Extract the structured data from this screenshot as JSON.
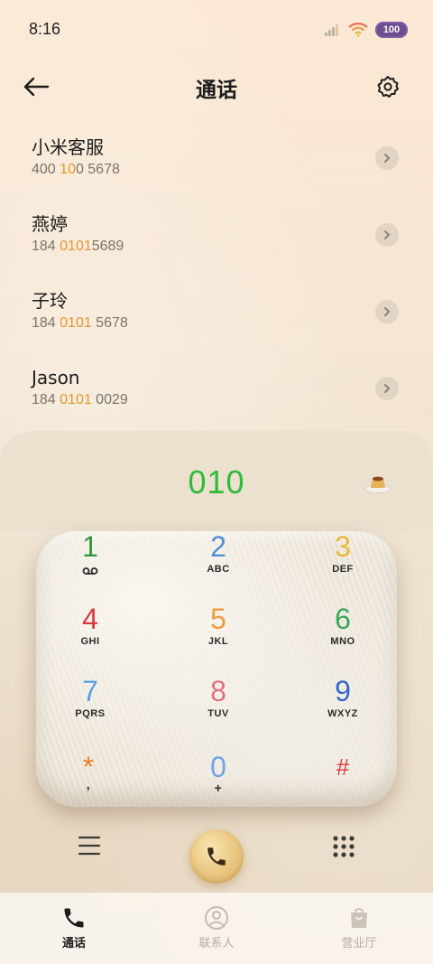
{
  "status_bar": {
    "time": "8:16",
    "battery": "100"
  },
  "header": {
    "title": "通话"
  },
  "contacts": [
    {
      "name": "小米客服",
      "number_parts": [
        "400 ",
        "10",
        "0 5678"
      ]
    },
    {
      "name": "燕婷",
      "number_parts": [
        "184 ",
        "0101",
        "5689"
      ]
    },
    {
      "name": "子玲",
      "number_parts": [
        "184 ",
        "0101",
        " 5678"
      ]
    },
    {
      "name": "Jason",
      "number_parts": [
        "184 ",
        "0101",
        " 0029"
      ]
    }
  ],
  "dialer": {
    "entered_number": "010"
  },
  "keypad": [
    {
      "digit": "1",
      "letters": "voicemail",
      "color": "#2e9a3b"
    },
    {
      "digit": "2",
      "letters": "ABC",
      "color": "#4f8fd8"
    },
    {
      "digit": "3",
      "letters": "DEF",
      "color": "#e6b83a"
    },
    {
      "digit": "4",
      "letters": "GHI",
      "color": "#d9393a"
    },
    {
      "digit": "5",
      "letters": "JKL",
      "color": "#ef9b3d"
    },
    {
      "digit": "6",
      "letters": "MNO",
      "color": "#3aa65a"
    },
    {
      "digit": "7",
      "letters": "PQRS",
      "color": "#5a9ee0"
    },
    {
      "digit": "8",
      "letters": "TUV",
      "color": "#e2707a"
    },
    {
      "digit": "9",
      "letters": "WXYZ",
      "color": "#3568c9"
    },
    {
      "digit": "*",
      "letters": ",",
      "color": "#f07a1e"
    },
    {
      "digit": "0",
      "letters": "+",
      "color": "#6aa3e6"
    },
    {
      "digit": "#",
      "letters": "",
      "color": "#d9393a"
    }
  ],
  "tabs": [
    {
      "label": "通话",
      "icon": "phone-icon",
      "active": true
    },
    {
      "label": "联系人",
      "icon": "contacts-icon",
      "active": false
    },
    {
      "label": "营业厅",
      "icon": "store-bag-icon",
      "active": false
    }
  ],
  "colors": {
    "accent_green": "#2dbb3a",
    "highlight_orange": "#e8962f"
  }
}
